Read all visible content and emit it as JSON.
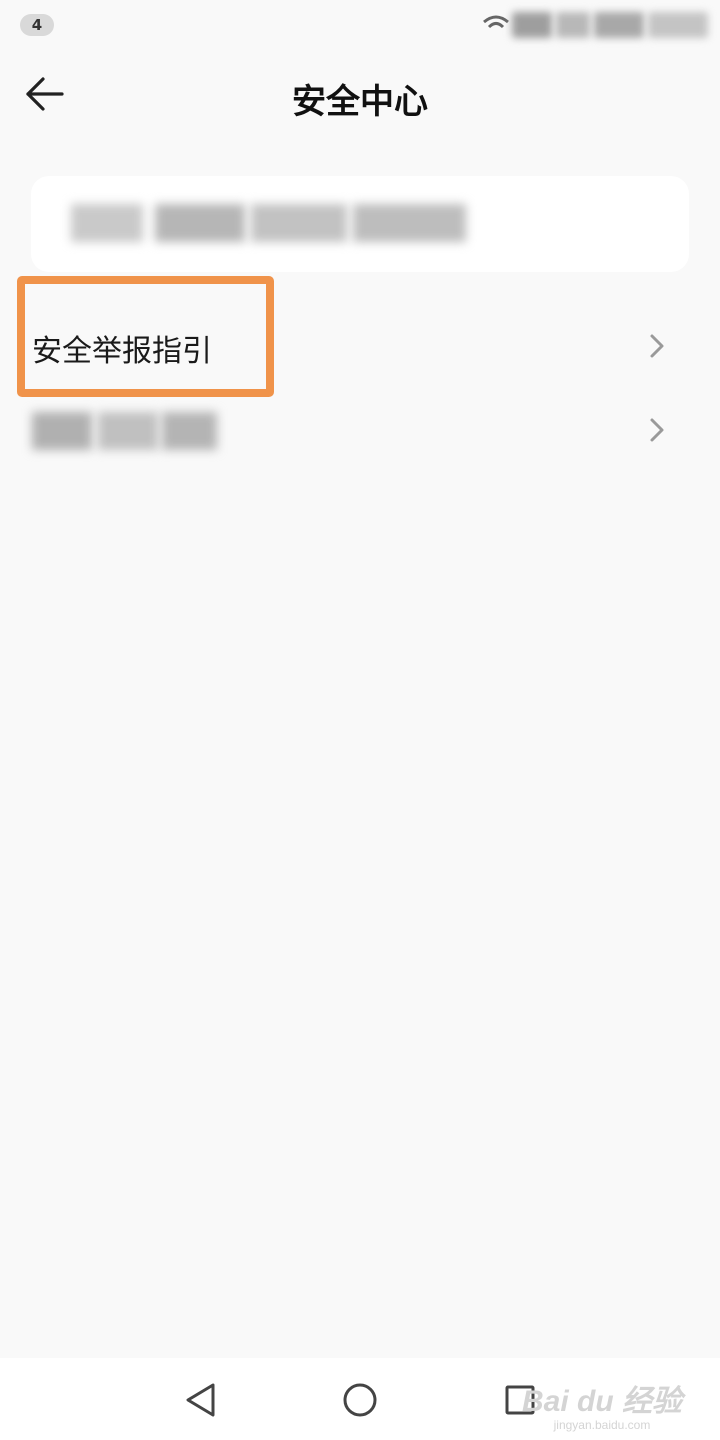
{
  "status_bar": {
    "notification_count": "4",
    "icons": [
      "wifi-icon",
      "nfc-icon",
      "battery-icon",
      "signal-icon"
    ]
  },
  "header": {
    "title": "安全中心",
    "back_icon": "arrow-left-icon"
  },
  "menu": {
    "items": [
      {
        "label": "安全举报指引",
        "icon": "chevron-right-icon",
        "highlighted": true
      },
      {
        "label": "",
        "icon": "chevron-right-icon",
        "highlighted": false
      }
    ]
  },
  "nav_bar": {
    "buttons": [
      "back-triangle-icon",
      "home-circle-icon",
      "recents-square-icon"
    ]
  },
  "watermark": {
    "brand": "Bai du 经验",
    "url": "jingyan.baidu.com"
  },
  "colors": {
    "background": "#f9f9f9",
    "card": "#ffffff",
    "highlight": "#f0934a",
    "chevron": "#9a9a9a"
  }
}
